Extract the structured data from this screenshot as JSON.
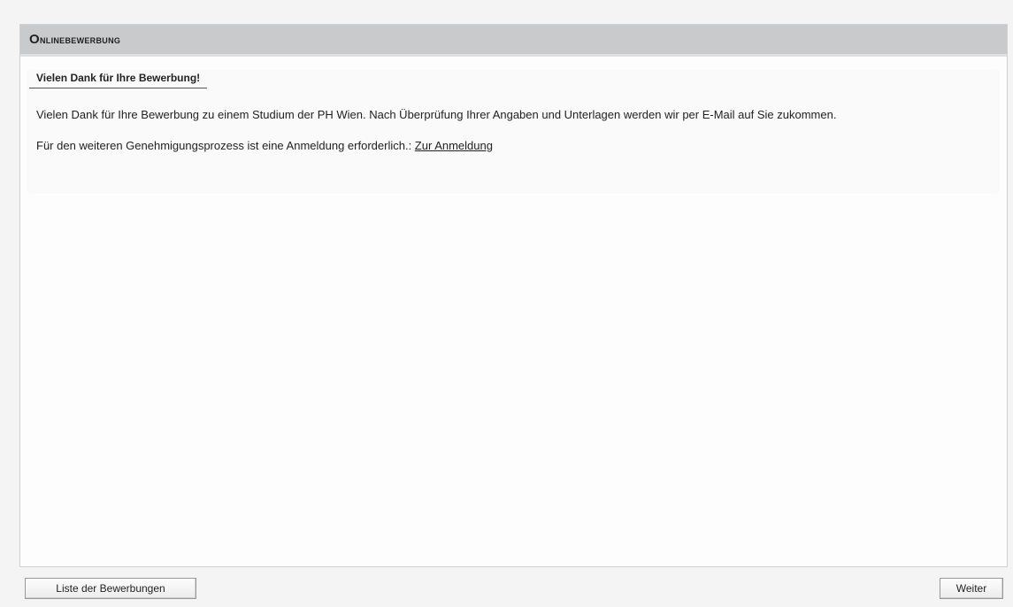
{
  "panel": {
    "title": "Onlinebewerbung"
  },
  "section": {
    "heading": "Vielen Dank für Ihre Bewerbung!",
    "paragraph1": "Vielen Dank für Ihre Bewerbung zu einem Studium der PH Wien. Nach Überprüfung Ihrer Angaben und Unterlagen werden wir per E-Mail auf Sie zukommen.",
    "paragraph2_text": "Für den weiteren Genehmigungsprozess ist eine Anmeldung erforderlich.: ",
    "login_link": "Zur Anmeldung"
  },
  "buttons": {
    "list_label": "Liste der Bewerbungen",
    "next_label": "Weiter"
  }
}
